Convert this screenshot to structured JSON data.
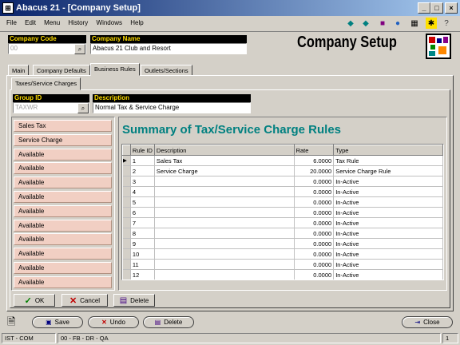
{
  "window": {
    "title": "Abacus 21 - [Company Setup]"
  },
  "menu": {
    "items": [
      "File",
      "Edit",
      "Menu",
      "History",
      "Windows",
      "Help"
    ]
  },
  "header": {
    "company_code_label": "Company Code",
    "company_code_value": "00",
    "company_name_label": "Company Name",
    "company_name_value": "Abacus 21 Club and Resort",
    "page_title": "Company Setup"
  },
  "tabs": {
    "main": "Main",
    "company_defaults": "Company Defaults",
    "business_rules": "Business Rules",
    "outlets_sections": "Outlets/Sections"
  },
  "subtab": {
    "label": "Taxes/Service Charges"
  },
  "group": {
    "id_label": "Group ID",
    "id_value": "TAXWR",
    "desc_label": "Description",
    "desc_value": "Normal Tax & Service Charge"
  },
  "rule_buttons": [
    "Sales Tax",
    "Service Charge",
    "Available",
    "Available",
    "Available",
    "Available",
    "Available",
    "Available",
    "Available",
    "Available",
    "Available",
    "Available"
  ],
  "summary": {
    "title": "Summary of Tax/Service Charge Rules"
  },
  "table": {
    "headers": [
      "Rule ID",
      "Description",
      "Rate",
      "Type"
    ],
    "rows": [
      [
        "1",
        "Sales Tax",
        "6.0000",
        "Tax Rule"
      ],
      [
        "2",
        "Service Charge",
        "20.0000",
        "Service Charge Rule"
      ],
      [
        "3",
        "",
        "0.0000",
        "In-Active"
      ],
      [
        "4",
        "",
        "0.0000",
        "In-Active"
      ],
      [
        "5",
        "",
        "0.0000",
        "In-Active"
      ],
      [
        "6",
        "",
        "0.0000",
        "In-Active"
      ],
      [
        "7",
        "",
        "0.0000",
        "In-Active"
      ],
      [
        "8",
        "",
        "0.0000",
        "In-Active"
      ],
      [
        "9",
        "",
        "0.0000",
        "In-Active"
      ],
      [
        "10",
        "",
        "0.0000",
        "In-Active"
      ],
      [
        "11",
        "",
        "0.0000",
        "In-Active"
      ],
      [
        "12",
        "",
        "0.0000",
        "In-Active"
      ]
    ]
  },
  "actions": {
    "ok": "OK",
    "cancel": "Cancel",
    "delete": "Delete"
  },
  "footer": {
    "save": "Save",
    "undo": "Undo",
    "delete": "Delete",
    "close": "Close"
  },
  "status": {
    "left": "IST - COM",
    "mid": "00 - FB - DR - QA",
    "right": "1"
  }
}
